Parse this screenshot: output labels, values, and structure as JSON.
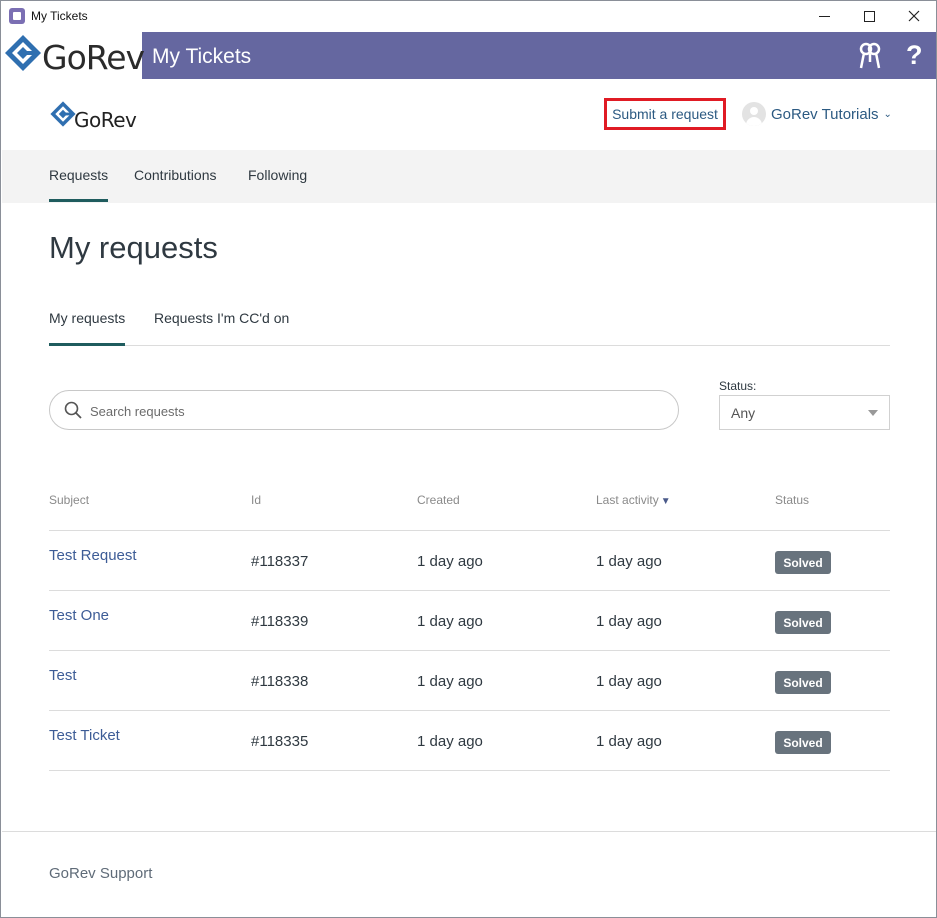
{
  "window": {
    "title": "My Tickets"
  },
  "appbar": {
    "logo_text": "GoRev",
    "title": "My Tickets",
    "help_glyph": "?"
  },
  "header": {
    "logo_text": "GoRev",
    "submit_label": "Submit a request",
    "user_name": "GoRev Tutorials",
    "user_chevron": "⌄"
  },
  "subnav": {
    "items": [
      {
        "label": "Requests"
      },
      {
        "label": "Contributions"
      },
      {
        "label": "Following"
      }
    ]
  },
  "page": {
    "title": "My requests"
  },
  "tabs": [
    {
      "label": "My requests"
    },
    {
      "label": "Requests I'm CC'd on"
    }
  ],
  "search": {
    "placeholder": "Search requests"
  },
  "status_filter": {
    "label": "Status:",
    "value": "Any"
  },
  "table": {
    "columns": [
      "Subject",
      "Id",
      "Created",
      "Last activity",
      "Status"
    ],
    "sort_indicator": "▼",
    "rows": [
      {
        "subject": "Test Request",
        "id": "#118337",
        "created": "1 day ago",
        "activity": "1 day ago",
        "status": "Solved"
      },
      {
        "subject": "Test One",
        "id": "#118339",
        "created": "1 day ago",
        "activity": "1 day ago",
        "status": "Solved"
      },
      {
        "subject": "Test",
        "id": "#118338",
        "created": "1 day ago",
        "activity": "1 day ago",
        "status": "Solved"
      },
      {
        "subject": "Test Ticket",
        "id": "#118335",
        "created": "1 day ago",
        "activity": "1 day ago",
        "status": "Solved"
      }
    ]
  },
  "footer": {
    "text": "GoRev Support"
  },
  "colors": {
    "appbar": "#6567a0",
    "link": "#3d5c96",
    "accent_underline": "#1f5c5e",
    "badge": "#68737d",
    "highlight_box": "#e01b24"
  }
}
